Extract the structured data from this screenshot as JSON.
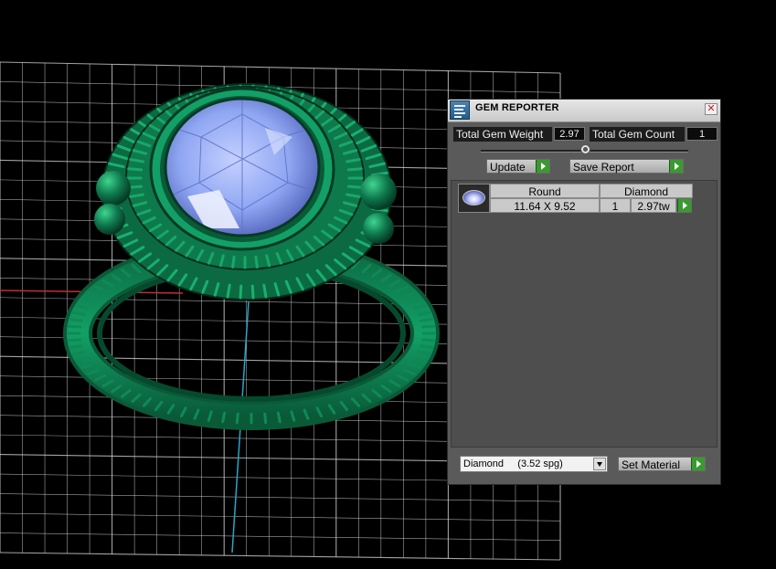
{
  "viewport": {
    "model_color": "#0f7a4e",
    "gem_color": "#8fa6f2",
    "grid_color": "#d9d9d9"
  },
  "panel": {
    "title": "GEM REPORTER",
    "close_glyph": "✕",
    "total_weight_label": "Total Gem Weight",
    "total_weight_value": "2.97",
    "total_count_label": "Total Gem Count",
    "total_count_value": "1",
    "update_label": "Update",
    "save_label": "Save Report",
    "gems": [
      {
        "icon": "oval-gem-icon",
        "shape": "Round",
        "material": "Diamond",
        "size": "11.64 X 9.52",
        "count": "1",
        "weight": "2.97tw"
      }
    ],
    "material_selected": "Diamond     (3.52 spg)",
    "set_material_label": "Set Material",
    "accent_green": "#3a9a30"
  }
}
